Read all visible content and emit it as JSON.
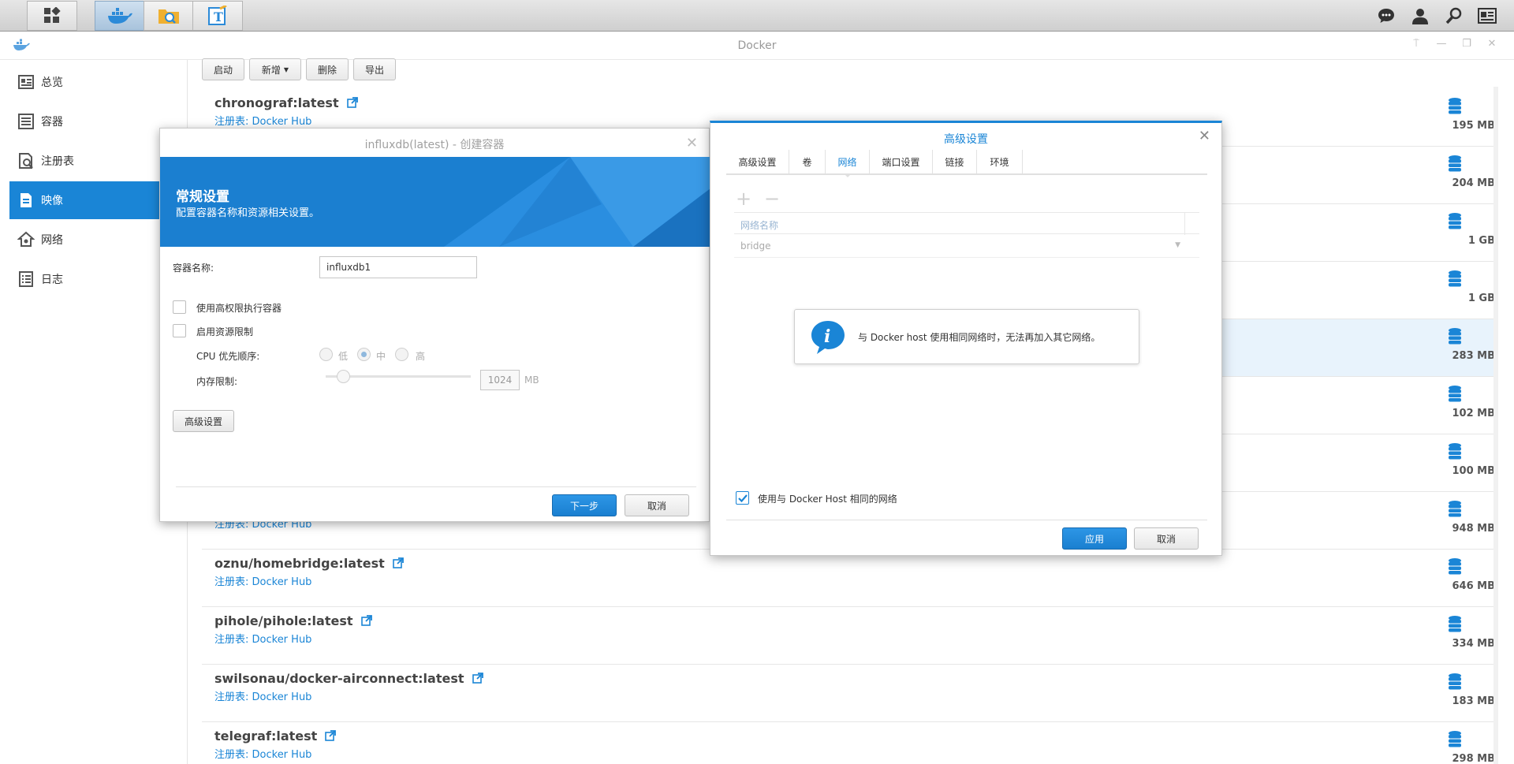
{
  "taskbar": {
    "apps": [
      "main-menu",
      "docker",
      "file-station",
      "text-editor"
    ]
  },
  "window": {
    "title": "Docker",
    "controls": [
      "pin",
      "minimize",
      "maximize",
      "close"
    ]
  },
  "sidebar": {
    "items": [
      {
        "label": "总览",
        "icon": "overview-icon"
      },
      {
        "label": "容器",
        "icon": "container-icon"
      },
      {
        "label": "注册表",
        "icon": "registry-icon"
      },
      {
        "label": "映像",
        "icon": "image-icon",
        "active": true
      },
      {
        "label": "网络",
        "icon": "network-icon"
      },
      {
        "label": "日志",
        "icon": "log-icon"
      }
    ]
  },
  "toolbar": {
    "launch": "启动",
    "add": "新增",
    "delete": "删除",
    "export": "导出"
  },
  "images": [
    {
      "name": "chronograf:latest",
      "registry": "注册表: Docker Hub",
      "size": "195 MB"
    },
    {
      "name": "",
      "registry": "",
      "size": "204 MB"
    },
    {
      "name": "",
      "registry": "",
      "size": "1 GB"
    },
    {
      "name": "",
      "registry": "",
      "size": "1 GB"
    },
    {
      "name": "",
      "registry": "",
      "size": "283 MB"
    },
    {
      "name": "",
      "registry": "",
      "size": "102 MB"
    },
    {
      "name": "",
      "registry": "",
      "size": "100 MB"
    },
    {
      "name": "",
      "registry": "注册表: Docker Hub",
      "size": "948 MB"
    },
    {
      "name": "oznu/homebridge:latest",
      "registry": "注册表: Docker Hub",
      "size": "646 MB"
    },
    {
      "name": "pihole/pihole:latest",
      "registry": "注册表: Docker Hub",
      "size": "334 MB"
    },
    {
      "name": "swilsonau/docker-airconnect:latest",
      "registry": "注册表: Docker Hub",
      "size": "183 MB"
    },
    {
      "name": "telegraf:latest",
      "registry": "注册表: Docker Hub",
      "size": "298 MB"
    }
  ],
  "create_dialog": {
    "title": "influxdb(latest) - 创建容器",
    "banner_title": "常规设置",
    "banner_subtitle": "配置容器名称和资源相关设置。",
    "container_name_label": "容器名称:",
    "container_name_value": "influxdb1",
    "high_priv_label": "使用高权限执行容器",
    "resource_limit_label": "启用资源限制",
    "cpu_label": "CPU 优先顺序:",
    "cpu_options": [
      "低",
      "中",
      "高"
    ],
    "cpu_selected": "中",
    "memory_label": "内存限制:",
    "memory_value": "1024",
    "memory_unit": "MB",
    "advanced_button": "高级设置",
    "next_button": "下一步",
    "cancel_button": "取消"
  },
  "advanced_dialog": {
    "title": "高级设置",
    "tabs": [
      "高级设置",
      "卷",
      "网络",
      "端口设置",
      "链接",
      "环境"
    ],
    "active_tab": "网络",
    "add_symbol": "+",
    "remove_symbol": "−",
    "column_header": "网络名称",
    "network_row": "bridge",
    "info_text": "与 Docker host 使用相同网络时，无法再加入其它网络。",
    "same_network_label": "使用与 Docker Host 相同的网络",
    "same_network_checked": true,
    "apply_button": "应用",
    "cancel_button": "取消"
  },
  "colors": {
    "accent": "#1a85d6",
    "sidebar_active": "#1a85d6"
  }
}
